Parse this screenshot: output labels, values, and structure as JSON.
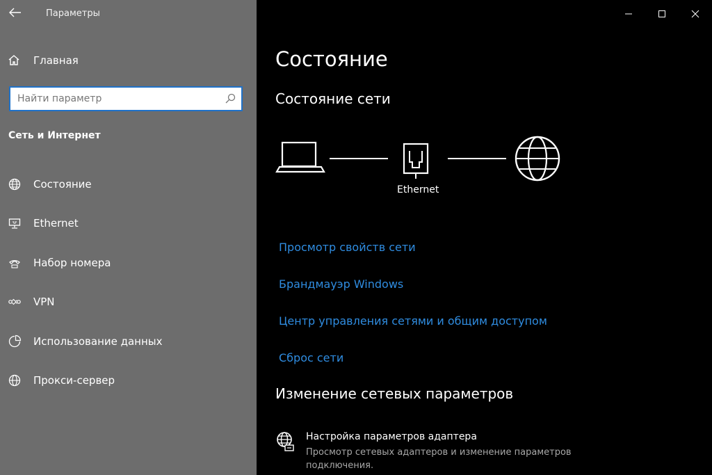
{
  "window": {
    "title": "Параметры"
  },
  "sidebar": {
    "home_label": "Главная",
    "search_placeholder": "Найти параметр",
    "section_title": "Сеть и Интернет",
    "items": [
      {
        "label": "Состояние",
        "icon": "globe-status-icon"
      },
      {
        "label": "Ethernet",
        "icon": "ethernet-monitor-icon"
      },
      {
        "label": "Набор номера",
        "icon": "dialup-icon"
      },
      {
        "label": "VPN",
        "icon": "vpn-icon"
      },
      {
        "label": "Использование данных",
        "icon": "data-usage-icon"
      },
      {
        "label": "Прокси-сервер",
        "icon": "globe-icon"
      }
    ]
  },
  "main": {
    "title": "Состояние",
    "network_status_title": "Состояние сети",
    "connection_label": "Ethernet",
    "links": [
      "Просмотр свойств сети",
      "Брандмауэр Windows",
      "Центр управления сетями и общим доступом",
      "Сброс сети"
    ],
    "change_title": "Изменение сетевых параметров",
    "adapter": {
      "title": "Настройка параметров адаптера",
      "description": "Просмотр сетевых адаптеров и изменение параметров подключения."
    }
  },
  "colors": {
    "accent": "#2f8ce0",
    "sidebar_bg": "#6d6d6d",
    "main_bg": "#000000",
    "search_border": "#1f72c9"
  }
}
